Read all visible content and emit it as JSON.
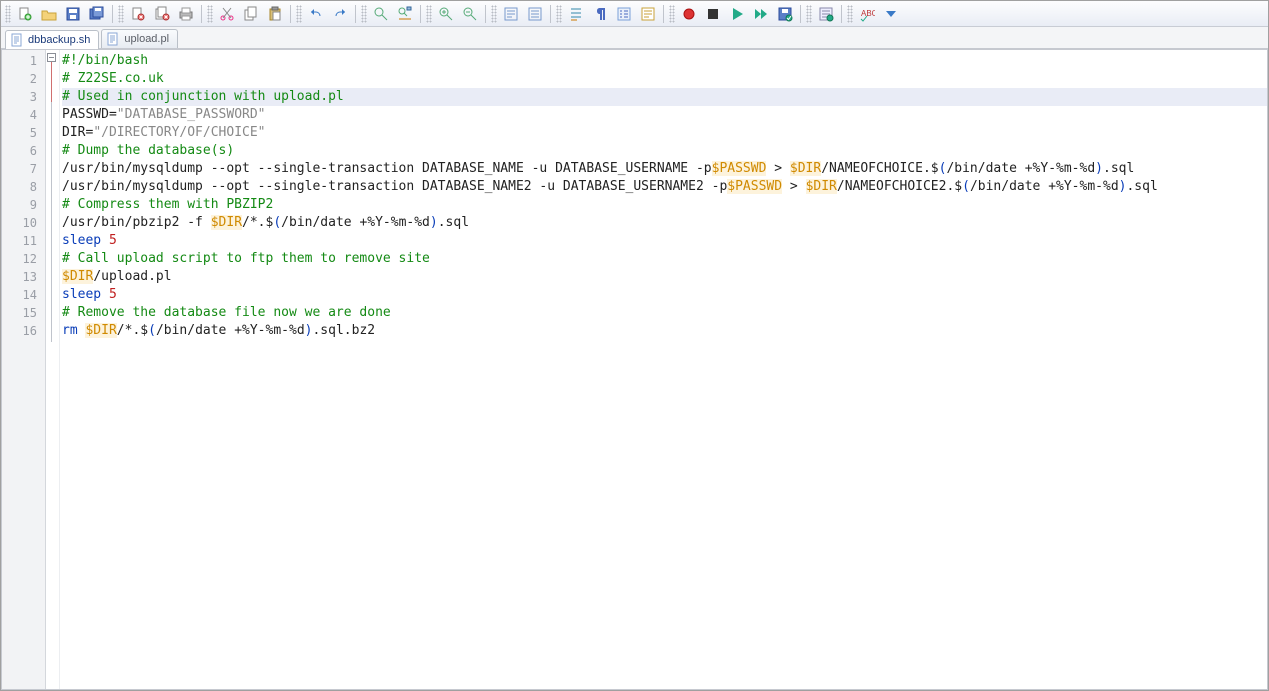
{
  "toolbar": {
    "icons": [
      "new-file-icon",
      "open-file-icon",
      "save-icon",
      "save-all-icon",
      "sep",
      "close-file-icon",
      "close-all-icon",
      "print-icon",
      "sep",
      "cut-icon",
      "copy-icon",
      "paste-icon",
      "sep",
      "undo-icon",
      "redo-icon",
      "sep",
      "find-icon",
      "find-replace-icon",
      "sep",
      "zoom-in-icon",
      "zoom-out-icon",
      "sep",
      "toggle-wrap-icon",
      "toggle-whitespace-icon",
      "sep",
      "indent-left-icon",
      "show-pilcrow-icon",
      "toggle-line-numbers-icon",
      "document-map-icon",
      "sep",
      "record-macro-icon",
      "stop-macro-icon",
      "play-macro-icon",
      "play-fast-icon",
      "save-macro-icon",
      "sep",
      "run-icon",
      "sep",
      "spellcheck-icon",
      "options-dropdown-icon"
    ]
  },
  "tabs": [
    {
      "label": "dbbackup.sh",
      "active": true
    },
    {
      "label": "upload.pl",
      "active": false
    }
  ],
  "editor": {
    "line_count": 16,
    "highlighted_line": 3,
    "lines": [
      [
        {
          "cls": "tok-com",
          "text": "#!/bin/bash"
        }
      ],
      [
        {
          "cls": "tok-com",
          "text": "# Z22SE.co.uk"
        }
      ],
      [
        {
          "cls": "tok-com",
          "text": "# Used in conjunction with upload.pl"
        }
      ],
      [
        {
          "cls": "",
          "text": "PASSWD="
        },
        {
          "cls": "tok-str",
          "text": "\"DATABASE_PASSWORD\""
        }
      ],
      [
        {
          "cls": "",
          "text": "DIR="
        },
        {
          "cls": "tok-str",
          "text": "\"/DIRECTORY/OF/CHOICE\""
        }
      ],
      [
        {
          "cls": "tok-com",
          "text": "# Dump the database(s)"
        }
      ],
      [
        {
          "cls": "",
          "text": "/usr/bin/mysqldump --opt --single-transaction DATABASE_NAME -u DATABASE_USERNAME -p"
        },
        {
          "cls": "tok-var",
          "text": "$PASSWD"
        },
        {
          "cls": "",
          "text": " > "
        },
        {
          "cls": "tok-var",
          "text": "$DIR"
        },
        {
          "cls": "",
          "text": "/NAMEOFCHOICE.$"
        },
        {
          "cls": "tok-fn",
          "text": "("
        },
        {
          "cls": "",
          "text": "/bin/date +%Y-%m-%d"
        },
        {
          "cls": "tok-fn",
          "text": ")"
        },
        {
          "cls": "",
          "text": ".sql"
        }
      ],
      [
        {
          "cls": "",
          "text": "/usr/bin/mysqldump --opt --single-transaction DATABASE_NAME2 -u DATABASE_USERNAME2 -p"
        },
        {
          "cls": "tok-var",
          "text": "$PASSWD"
        },
        {
          "cls": "",
          "text": " > "
        },
        {
          "cls": "tok-var",
          "text": "$DIR"
        },
        {
          "cls": "",
          "text": "/NAMEOFCHOICE2.$"
        },
        {
          "cls": "tok-fn",
          "text": "("
        },
        {
          "cls": "",
          "text": "/bin/date +%Y-%m-%d"
        },
        {
          "cls": "tok-fn",
          "text": ")"
        },
        {
          "cls": "",
          "text": ".sql"
        }
      ],
      [
        {
          "cls": "tok-com",
          "text": "# Compress them with PBZIP2"
        }
      ],
      [
        {
          "cls": "",
          "text": "/usr/bin/pbzip2 -f "
        },
        {
          "cls": "tok-var",
          "text": "$DIR"
        },
        {
          "cls": "",
          "text": "/*.$"
        },
        {
          "cls": "tok-fn",
          "text": "("
        },
        {
          "cls": "",
          "text": "/bin/date +%Y-%m-%d"
        },
        {
          "cls": "tok-fn",
          "text": ")"
        },
        {
          "cls": "",
          "text": ".sql"
        }
      ],
      [
        {
          "cls": "tok-kw",
          "text": "sleep"
        },
        {
          "cls": "",
          "text": " "
        },
        {
          "cls": "tok-num",
          "text": "5"
        }
      ],
      [
        {
          "cls": "tok-com",
          "text": "# Call upload script to ftp them to remove site"
        }
      ],
      [
        {
          "cls": "tok-var",
          "text": "$DIR"
        },
        {
          "cls": "",
          "text": "/upload.pl"
        }
      ],
      [
        {
          "cls": "tok-kw",
          "text": "sleep"
        },
        {
          "cls": "",
          "text": " "
        },
        {
          "cls": "tok-num",
          "text": "5"
        }
      ],
      [
        {
          "cls": "tok-com",
          "text": "# Remove the database file now we are done"
        }
      ],
      [
        {
          "cls": "tok-kw",
          "text": "rm"
        },
        {
          "cls": "",
          "text": " "
        },
        {
          "cls": "tok-var",
          "text": "$DIR"
        },
        {
          "cls": "",
          "text": "/*.$"
        },
        {
          "cls": "tok-fn",
          "text": "("
        },
        {
          "cls": "",
          "text": "/bin/date +%Y-%m-%d"
        },
        {
          "cls": "tok-fn",
          "text": ")"
        },
        {
          "cls": "",
          "text": ".sql.bz2"
        }
      ]
    ]
  }
}
